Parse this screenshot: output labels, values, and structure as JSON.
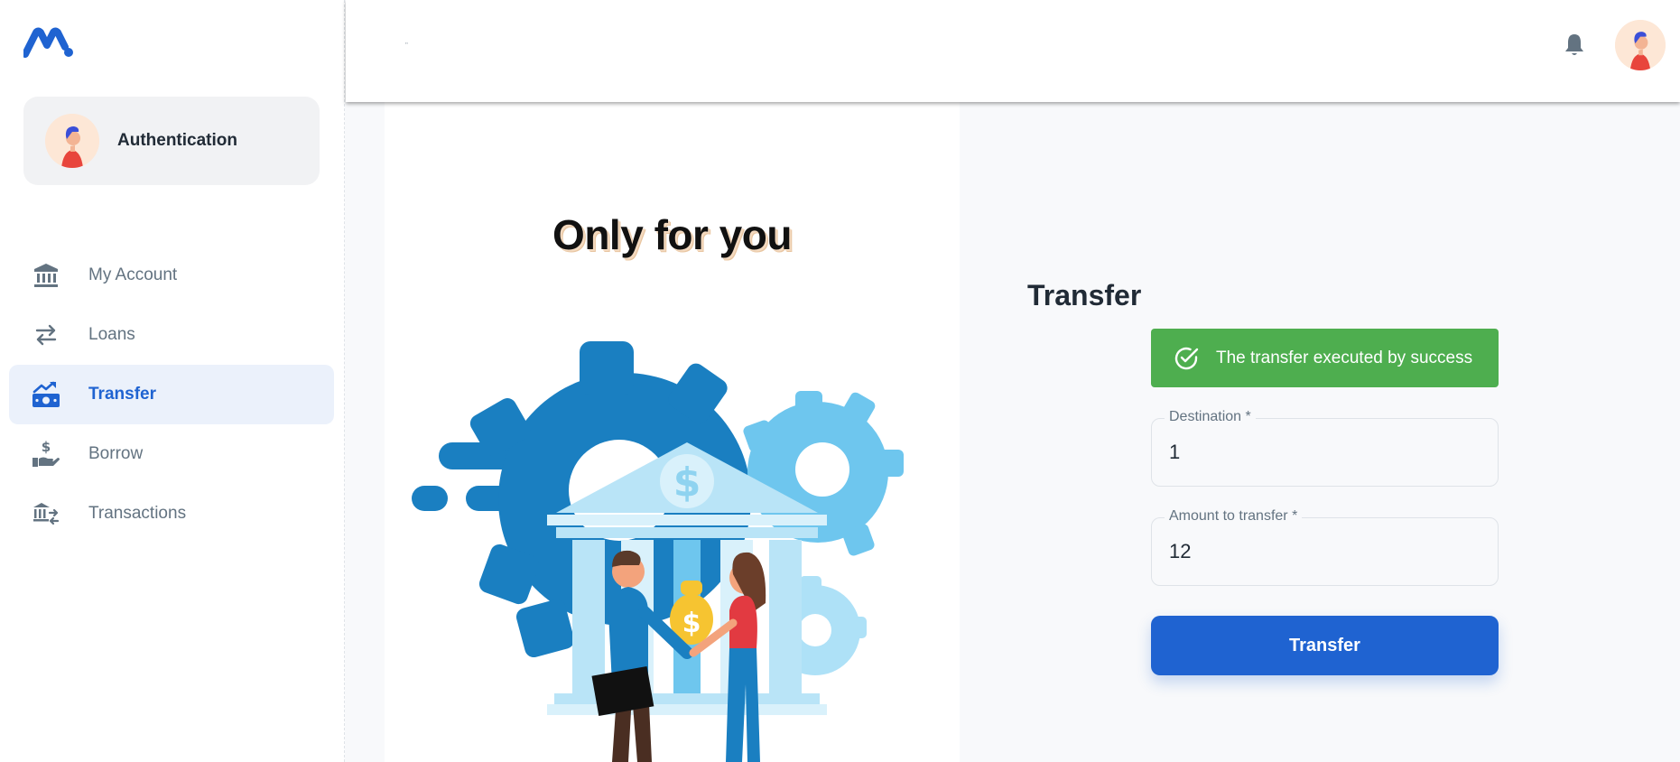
{
  "sidebar": {
    "account_name": "Authentication",
    "items": [
      {
        "label": "My Account",
        "icon": "bank-icon"
      },
      {
        "label": "Loans",
        "icon": "swap-arrows-icon"
      },
      {
        "label": "Transfer",
        "icon": "money-transfer-icon",
        "active": true
      },
      {
        "label": "Borrow",
        "icon": "hand-dollar-icon"
      },
      {
        "label": "Transactions",
        "icon": "bank-transfer-icon"
      }
    ]
  },
  "header": {
    "breadcrumb_mark": "\""
  },
  "main": {
    "slogan": "Only for you",
    "form_title": "Transfer",
    "alert_text": "The transfer executed by success",
    "destination_label": "Destination *",
    "destination_value": "1",
    "amount_label": "Amount to transfer *",
    "amount_value": "12",
    "submit_label": "Transfer"
  },
  "colors": {
    "primary": "#1f63d1",
    "success": "#4eae4f",
    "active_bg": "#ebf1fb"
  }
}
